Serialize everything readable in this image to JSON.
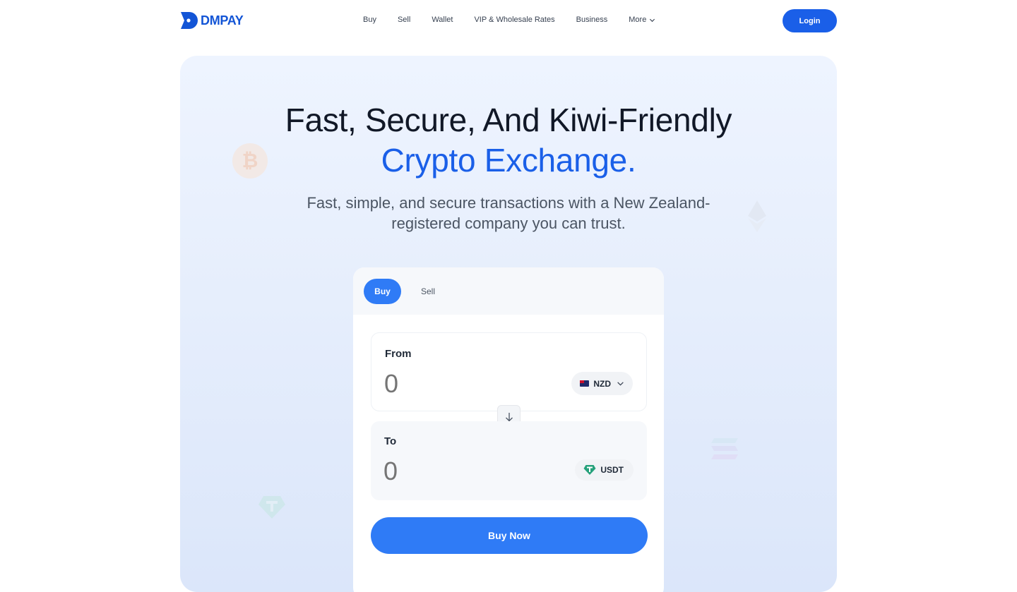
{
  "brand": {
    "name": "DMPAY",
    "color": "#1355d6"
  },
  "nav": {
    "items": [
      {
        "label": "Buy"
      },
      {
        "label": "Sell"
      },
      {
        "label": "Wallet"
      },
      {
        "label": "VIP & Wholesale Rates"
      },
      {
        "label": "Business"
      },
      {
        "label": "More"
      }
    ],
    "login_label": "Login"
  },
  "hero": {
    "title_line1": "Fast, Secure, And Kiwi-Friendly",
    "title_line2": "Crypto Exchange.",
    "subtitle": "Fast, simple, and secure transactions with a New Zealand-registered company you can trust.",
    "accent_color": "#1a5fe8"
  },
  "widget": {
    "tabs": [
      {
        "label": "Buy",
        "active": true
      },
      {
        "label": "Sell",
        "active": false
      }
    ],
    "from": {
      "label": "From",
      "value": "0",
      "currency": "NZD",
      "currency_icon": "nz-flag-icon"
    },
    "to": {
      "label": "To",
      "value": "0",
      "currency": "USDT",
      "currency_icon": "tether-icon"
    },
    "swap_icon": "arrow-down-icon",
    "submit_label": "Buy Now"
  }
}
